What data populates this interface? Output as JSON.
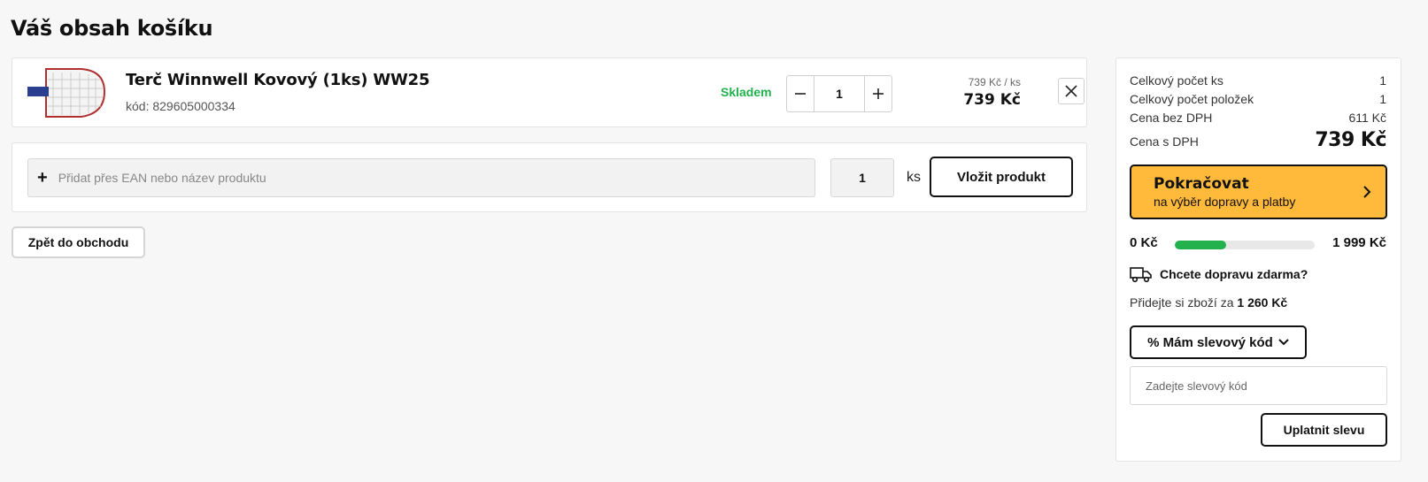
{
  "page": {
    "title": "Váš obsah košíku"
  },
  "cart_item": {
    "name": "Terč Winnwell Kovový (1ks) WW25",
    "code_label": "kód: 829605000334",
    "stock": "Skladem",
    "quantity": "1",
    "unit_price": "739 Kč / ks",
    "total_price": "739 Kč",
    "icons": {
      "minus": "minus-icon",
      "plus": "plus-icon",
      "remove": "close-icon"
    }
  },
  "add_product": {
    "placeholder": "Přidat přes EAN nebo název produktu",
    "quantity": "1",
    "unit": "ks",
    "button_label": "Vložit produkt"
  },
  "back_button": "Zpět do obchodu",
  "summary": {
    "rows": [
      {
        "label": "Celkový počet ks",
        "value": "1"
      },
      {
        "label": "Celkový počet položek",
        "value": "1"
      },
      {
        "label": "Cena bez DPH",
        "value": "611 Kč"
      },
      {
        "label": "Cena s DPH",
        "value": "739 Kč"
      }
    ],
    "continue_title": "Pokračovat",
    "continue_subtitle": "na výběr dopravy a platby",
    "shipping": {
      "from": "0 Kč",
      "to": "1 999 Kč",
      "progress_fraction": 0.37,
      "question": "Chcete dopravu zdarma?",
      "add_more_prefix": "Přidejte si zboží za ",
      "add_more_amount": "1 260 Kč"
    },
    "discount_toggle": "% Mám slevový kód",
    "discount_placeholder": "Zadejte slevový kód",
    "apply_button": "Uplatnit slevu"
  },
  "colors": {
    "accent": "#ffb93b",
    "stock_green": "#22b14c"
  }
}
